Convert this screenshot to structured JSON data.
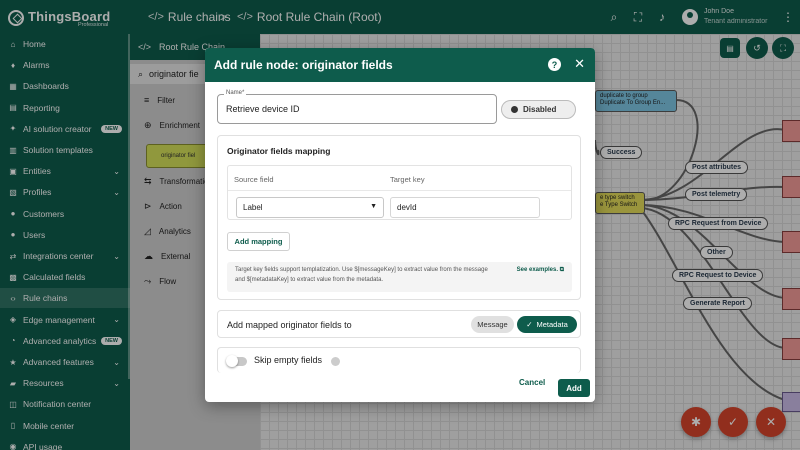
{
  "app": {
    "logo_name": "ThingsBoard",
    "logo_sub": "Professional"
  },
  "breadcrumbs": {
    "first": "Rule chains",
    "separator": ">",
    "second": "Root Rule Chain (Root)"
  },
  "user": {
    "name": "John Doe",
    "role": "Tenant administrator"
  },
  "sidebar": {
    "items": [
      {
        "label": "Home",
        "icon": "home-icon"
      },
      {
        "label": "Alarms",
        "icon": "alarm-icon"
      },
      {
        "label": "Dashboards",
        "icon": "dashboard-icon"
      },
      {
        "label": "Reporting",
        "icon": "report-icon"
      },
      {
        "label": "AI solution creator",
        "icon": "ai-icon",
        "badge": "NEW"
      },
      {
        "label": "Solution templates",
        "icon": "template-icon"
      },
      {
        "label": "Entities",
        "icon": "entities-icon",
        "expandable": true
      },
      {
        "label": "Profiles",
        "icon": "profiles-icon",
        "expandable": true
      },
      {
        "label": "Customers",
        "icon": "customers-icon"
      },
      {
        "label": "Users",
        "icon": "users-icon"
      },
      {
        "label": "Integrations center",
        "icon": "integrations-icon",
        "expandable": true
      },
      {
        "label": "Calculated fields",
        "icon": "calc-icon"
      },
      {
        "label": "Rule chains",
        "icon": "rule-chain-icon",
        "active": true
      },
      {
        "label": "Edge management",
        "icon": "edge-icon",
        "expandable": true
      },
      {
        "label": "Advanced analytics",
        "icon": "analytics-icon",
        "badge": "NEW"
      },
      {
        "label": "Advanced features",
        "icon": "features-icon",
        "expandable": true
      },
      {
        "label": "Resources",
        "icon": "resources-icon",
        "expandable": true
      },
      {
        "label": "Notification center",
        "icon": "notification-icon"
      },
      {
        "label": "Mobile center",
        "icon": "mobile-icon"
      },
      {
        "label": "API usage",
        "icon": "api-icon"
      }
    ]
  },
  "rule_chain_panel": {
    "title": "Root Rule Chain",
    "search_value": "originator fie",
    "categories": [
      "Filter",
      "Enrichment",
      "Transformation",
      "Action",
      "Analytics",
      "External",
      "Flow"
    ],
    "found_node": "originator fiel"
  },
  "canvas": {
    "node_duplicate": {
      "line1": "duplicate to group",
      "line2": "Duplicate To Group En..."
    },
    "node_switch": {
      "line1": "e type switch",
      "line2": "e Type Switch"
    },
    "labels": [
      "Success",
      "Post attributes",
      "Post telemetry",
      "RPC Request from Device",
      "Other",
      "RPC Request to Device",
      "Generate Report"
    ]
  },
  "dialog": {
    "title": "Add rule node: originator fields",
    "name_label": "Name",
    "name_required_mark": "*",
    "name_value": "Retrieve device ID",
    "disabled_label": "Disabled",
    "mapping_title": "Originator fields mapping",
    "col_source": "Source field",
    "col_target": "Target key",
    "row_source": "Label",
    "row_target": "devId",
    "add_mapping": "Add mapping",
    "hint_text": "Target key fields support templatization. Use $[messageKey] to extract value from the message and $[metadataKey] to extract value from the metadata.",
    "see_examples": "See examples.",
    "add_to_label": "Add mapped originator fields to",
    "option_message": "Message",
    "option_metadata": "Metadata",
    "selected_option": "Metadata",
    "skip_label": "Skip empty fields",
    "skip_enabled": false,
    "cancel": "Cancel",
    "add": "Add"
  },
  "colors": {
    "primary": "#0e5c4c",
    "danger": "#d6452c"
  }
}
